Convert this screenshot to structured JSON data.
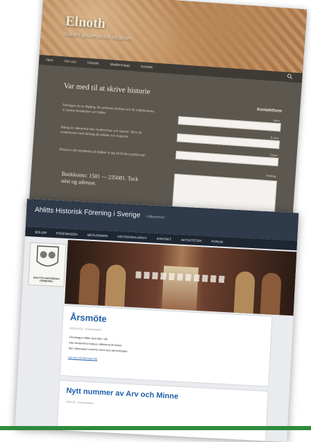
{
  "page1": {
    "site_title": "Elnoth",
    "tagline": "Lorem ipsum dolor sit amet",
    "nav": [
      "Hem",
      "Om oss",
      "Historik",
      "Medlemskap",
      "Kontakt"
    ],
    "heading": "Var med til at skrive historie",
    "para1": "Tidningen är en tillgång, för arkivens historia och för släktforskare. Vi samlar berättelser och bilder.",
    "para2": "Bidrag är välkomna från medlemmar och vänner. Skriv till redaktionen med förslag på artiklar och material.",
    "para3": "Skicka in din berättelse så hjälper vi dig att få den publicerad.",
    "quote": "Bankkonto: 1581 — 235081. Tack näst og adresse.",
    "sidebar_title": "Kontaktform",
    "field_labels": [
      "Navn",
      "E-post",
      "Emne",
      "Melding"
    ]
  },
  "page2": {
    "site_title": "Ahlitts Historisk Förening i Sverige",
    "site_sub": "Välkommen",
    "nav": [
      "BÖLOM",
      "FÖRENINGEN",
      "MEDLEMMAR",
      "HISTORISKA ARKIV",
      "KONTAKT",
      "AKTIVITETER",
      "FORUM"
    ],
    "logo_text": "AHLITTS HISTORISKA FÖRENING",
    "post1": {
      "title": "Årsmöte",
      "meta": "2020-04-02   ·   Kommentarer",
      "lines": [
        "Föreningen håller årsmöte i vår.",
        "Alla medlemmar hälsas välkomna till mötet.",
        "Mer information kommer inom kort på hemsidan."
      ],
      "link": "Läs mer om årsmötet här"
    },
    "post2": {
      "title": "Nytt nummer av Arv och Minne",
      "meta": "2020-03   ·   Kommentarer"
    }
  }
}
